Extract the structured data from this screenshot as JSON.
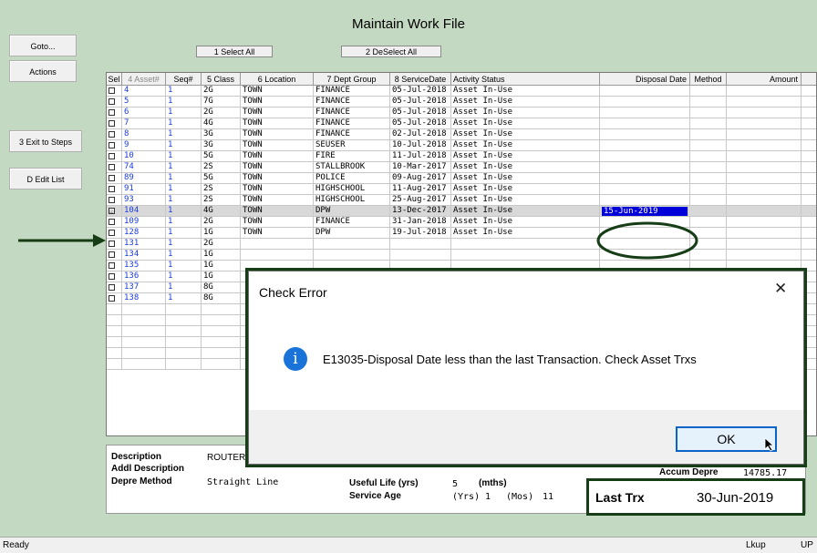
{
  "window": {
    "title": "Maintain Work File"
  },
  "left_buttons": {
    "goto": "Goto...",
    "actions": "Actions",
    "exit": "3 Exit to Steps",
    "edit": "D Edit List"
  },
  "top_buttons": {
    "select_all": "1 Select All",
    "deselect_all": "2 DeSelect All"
  },
  "grid": {
    "headers": {
      "sel": "Sel",
      "asset": "4 Asset#",
      "seq": "Seq#",
      "class": "5 Class",
      "location": "6 Location",
      "dept": "7 Dept Group",
      "service_date": "8 ServiceDate",
      "activity": "Activity Status",
      "disposal": "Disposal Date",
      "method": "Method",
      "amount": "Amount"
    },
    "rows": [
      {
        "asset": "4",
        "seq": "1",
        "cls": "2G",
        "loc": "TOWN",
        "dept": "FINANCE",
        "date": "05-Jul-2018",
        "status": "Asset In-Use"
      },
      {
        "asset": "5",
        "seq": "1",
        "cls": "7G",
        "loc": "TOWN",
        "dept": "FINANCE",
        "date": "05-Jul-2018",
        "status": "Asset In-Use"
      },
      {
        "asset": "6",
        "seq": "1",
        "cls": "2G",
        "loc": "TOWN",
        "dept": "FINANCE",
        "date": "05-Jul-2018",
        "status": "Asset In-Use"
      },
      {
        "asset": "7",
        "seq": "1",
        "cls": "4G",
        "loc": "TOWN",
        "dept": "FINANCE",
        "date": "05-Jul-2018",
        "status": "Asset In-Use"
      },
      {
        "asset": "8",
        "seq": "1",
        "cls": "3G",
        "loc": "TOWN",
        "dept": "FINANCE",
        "date": "02-Jul-2018",
        "status": "Asset In-Use"
      },
      {
        "asset": "9",
        "seq": "1",
        "cls": "3G",
        "loc": "TOWN",
        "dept": "SEUSER",
        "date": "10-Jul-2018",
        "status": "Asset In-Use"
      },
      {
        "asset": "10",
        "seq": "1",
        "cls": "5G",
        "loc": "TOWN",
        "dept": "FIRE",
        "date": "11-Jul-2018",
        "status": "Asset In-Use"
      },
      {
        "asset": "74",
        "seq": "1",
        "cls": "2S",
        "loc": "TOWN",
        "dept": "STALLBROOK",
        "date": "10-Mar-2017",
        "status": "Asset In-Use"
      },
      {
        "asset": "89",
        "seq": "1",
        "cls": "5G",
        "loc": "TOWN",
        "dept": "POLICE",
        "date": "09-Aug-2017",
        "status": "Asset In-Use"
      },
      {
        "asset": "91",
        "seq": "1",
        "cls": "2S",
        "loc": "TOWN",
        "dept": "HIGHSCHOOL",
        "date": "11-Aug-2017",
        "status": "Asset In-Use"
      },
      {
        "asset": "93",
        "seq": "1",
        "cls": "2S",
        "loc": "TOWN",
        "dept": "HIGHSCHOOL",
        "date": "25-Aug-2017",
        "status": "Asset In-Use"
      },
      {
        "asset": "104",
        "seq": "1",
        "cls": "4G",
        "loc": "TOWN",
        "dept": "DPW",
        "date": "13-Dec-2017",
        "status": "Asset In-Use",
        "disposal": "15-Jun-2019",
        "checked": "☑"
      },
      {
        "asset": "109",
        "seq": "1",
        "cls": "2G",
        "loc": "TOWN",
        "dept": "FINANCE",
        "date": "31-Jan-2018",
        "status": "Asset In-Use"
      },
      {
        "asset": "128",
        "seq": "1",
        "cls": "1G",
        "loc": "TOWN",
        "dept": "DPW",
        "date": "19-Jul-2018",
        "status": "Asset In-Use"
      },
      {
        "asset": "131",
        "seq": "1",
        "cls": "2G",
        "loc": "",
        "dept": "",
        "date": "",
        "status": ""
      },
      {
        "asset": "134",
        "seq": "1",
        "cls": "1G",
        "loc": "",
        "dept": "",
        "date": "",
        "status": ""
      },
      {
        "asset": "135",
        "seq": "1",
        "cls": "1G",
        "loc": "",
        "dept": "",
        "date": "",
        "status": ""
      },
      {
        "asset": "136",
        "seq": "1",
        "cls": "1G",
        "loc": "",
        "dept": "",
        "date": "",
        "status": ""
      },
      {
        "asset": "137",
        "seq": "1",
        "cls": "8G",
        "loc": "",
        "dept": "",
        "date": "",
        "status": ""
      },
      {
        "asset": "138",
        "seq": "1",
        "cls": "8G",
        "loc": "",
        "dept": "",
        "date": "",
        "status": ""
      }
    ]
  },
  "details": {
    "description_label": "Description",
    "description_value": "ROUTER",
    "addl_label": "Addl Description",
    "method_label": "Depre Method",
    "method_value": "Straight Line",
    "life_label": "Useful Life (yrs)",
    "life_value": "5",
    "mths_label": "(mths)",
    "age_label": "Service Age",
    "age_yrs_label": "(Yrs)",
    "age_yrs": "1",
    "age_mos_label": "(Mos)",
    "age_mos": "11",
    "accum_label": "Accum Depre",
    "accum_value": "14785.17",
    "last_trx_label": "Last Trx",
    "last_trx_value": "30-Jun-2019"
  },
  "dialog": {
    "title": "Check Error",
    "message": "E13035-Disposal Date less than the last Transaction. Check Asset Trxs",
    "ok": "OK",
    "close": "✕",
    "icon": "i"
  },
  "status": {
    "ready": "Ready",
    "lkup": "Lkup",
    "up": "UP"
  },
  "colors": {
    "background": "#c4d9c1",
    "highlight": "#0000d8",
    "annotation": "#173d17",
    "info_icon": "#1a73d9"
  }
}
